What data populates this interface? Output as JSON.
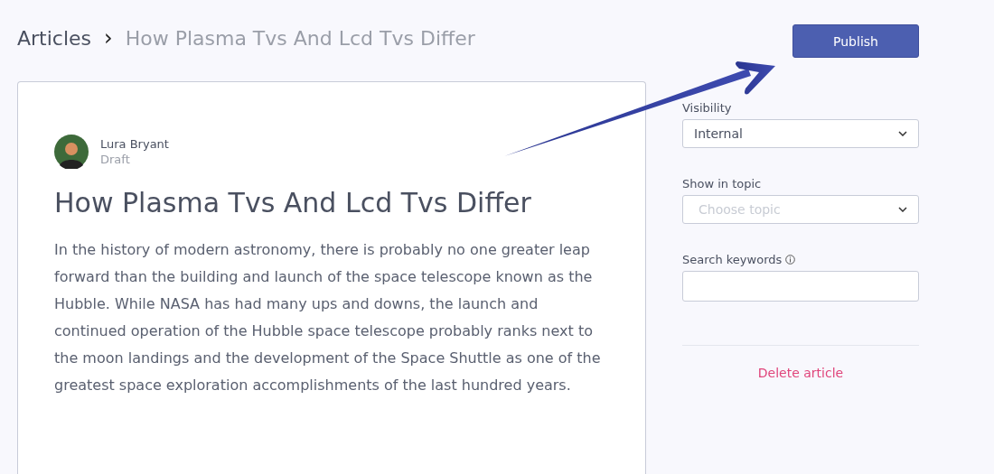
{
  "breadcrumb": {
    "parent": "Articles",
    "separator": "›",
    "current": "How Plasma Tvs And Lcd Tvs Differ"
  },
  "article": {
    "author": "Lura Bryant",
    "status": "Draft",
    "title": "How Plasma Tvs And Lcd Tvs Differ",
    "body": "In the history of modern astronomy, there is probably no one greater leap forward than the building and launch of the space telescope known as the Hubble. While NASA has had many ups and downs, the launch and continued operation of the Hubble space telescope probably ranks next to the moon landings and the development of the Space Shuttle as one of the greatest space exploration accomplishments of the last hundred years."
  },
  "publish_button": "Publish",
  "fields": [
    {
      "kind": "select",
      "label": "Visibility",
      "value": "Internal"
    },
    {
      "kind": "select",
      "label": "Show in topic",
      "placeholder": "Choose topic"
    },
    {
      "kind": "text",
      "label": "Search keywords",
      "info": true
    }
  ],
  "delete_link": "Delete article"
}
